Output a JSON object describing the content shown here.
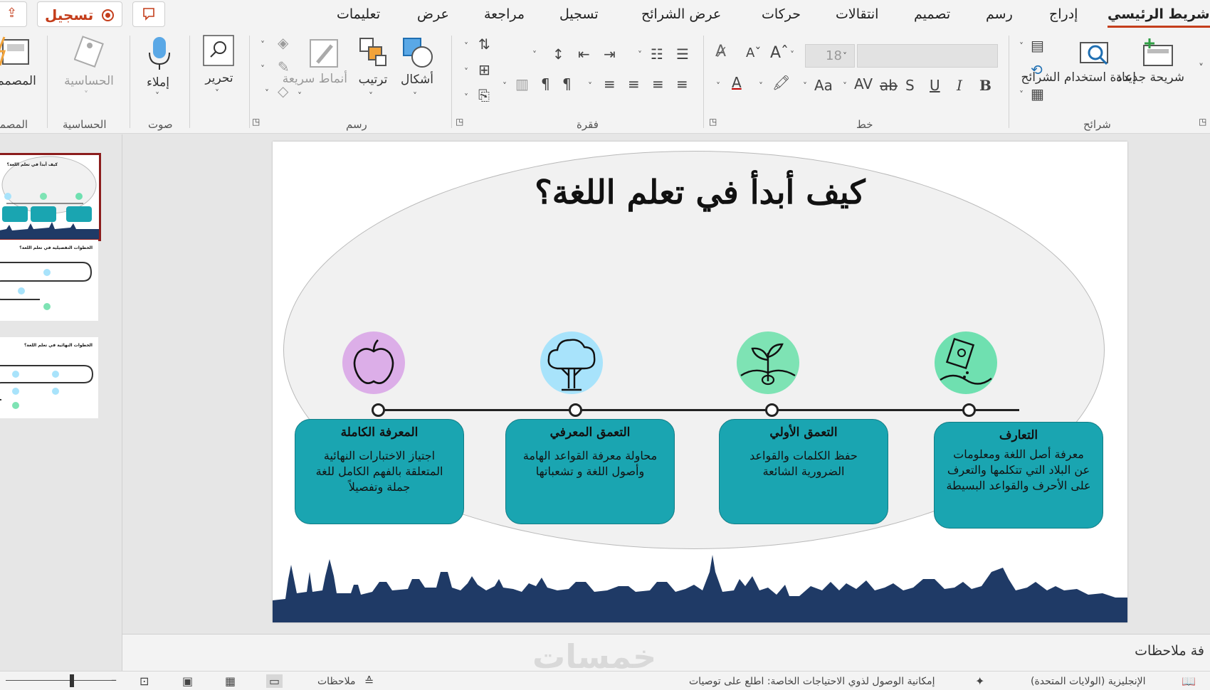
{
  "tabs": [
    {
      "label": "شريط الرئيسي",
      "active": true
    },
    {
      "label": "إدراج"
    },
    {
      "label": "رسم"
    },
    {
      "label": "تصميم"
    },
    {
      "label": "انتقالات"
    },
    {
      "label": "حركات"
    },
    {
      "label": "عرض الشرائح"
    },
    {
      "label": "تسجيل"
    },
    {
      "label": "مراجعة"
    },
    {
      "label": "عرض"
    },
    {
      "label": "تعليمات"
    }
  ],
  "quick": {
    "record_label": "تسجيل",
    "accent": "#c43e1c"
  },
  "ribbon": {
    "slides": {
      "new_slide": "شريحة جديدة",
      "reuse": "إعادة استخدام الشرائح",
      "group": "شرائح"
    },
    "font": {
      "size": "18",
      "group": "خط",
      "bold": "B",
      "italic": "I",
      "underline": "U",
      "shadow": "S",
      "strike": "ab",
      "spacing": "AV",
      "case": "Aa"
    },
    "paragraph": {
      "group": "فقرة"
    },
    "drawing": {
      "shapes": "أشكال",
      "arrange": "ترتيب",
      "quick_styles": "أنماط سريعة",
      "group": "رسم"
    },
    "editing": {
      "label": "تحرير"
    },
    "voice": {
      "dictate": "إملاء",
      "group": "صوت"
    },
    "sensitivity": {
      "label": "الحساسية",
      "group": "الحساسية"
    },
    "designer": {
      "label": "المصمم",
      "group": "المصمم"
    }
  },
  "thumbnails": [
    {
      "title": "كيف أبدأ في تعلم اللغة؟"
    },
    {
      "title": "الخطوات التفصيلية في تعلم اللغة؟"
    },
    {
      "title": "الخطوات النهائية في تعلم اللغة؟"
    }
  ],
  "slide": {
    "title": "كيف أبدأ في تعلم اللغة؟",
    "steps": [
      {
        "title": "التعارف",
        "desc": "معرفة أصل اللغة ومعلومات عن البلاد التي تتكلمها والتعرف على الأحرف والقواعد البسيطة",
        "icon": "seed-packet-icon",
        "color": "#6fe0b0"
      },
      {
        "title": "التعمق الأولي",
        "desc": "حفظ الكلمات والقواعد الضرورية الشائعة",
        "icon": "sprout-icon",
        "color": "#7ee3b4"
      },
      {
        "title": "التعمق المعرفي",
        "desc": "محاولة معرفة القواعد الهامة وأصول اللغة و تشعباتها",
        "icon": "tree-icon",
        "color": "#a8e3fb"
      },
      {
        "title": "المعرفة الكاملة",
        "desc": "اجتياز الاختبارات النهائية المتعلقة بالفهم الكامل للغة جملة وتفصيلاً",
        "icon": "apple-icon",
        "color": "#dcaee8"
      }
    ],
    "box_color": "#1aa5b1",
    "skyline_color": "#1f3a66"
  },
  "notes": {
    "placeholder": "فة ملاحظات",
    "watermark": "خمسات"
  },
  "status": {
    "language": "الإنجليزية (الولايات المتحدة)",
    "accessibility": "إمكانية الوصول لذوي الاحتياجات الخاصة: اطلع على توصيات",
    "notes_btn": "ملاحظات"
  }
}
